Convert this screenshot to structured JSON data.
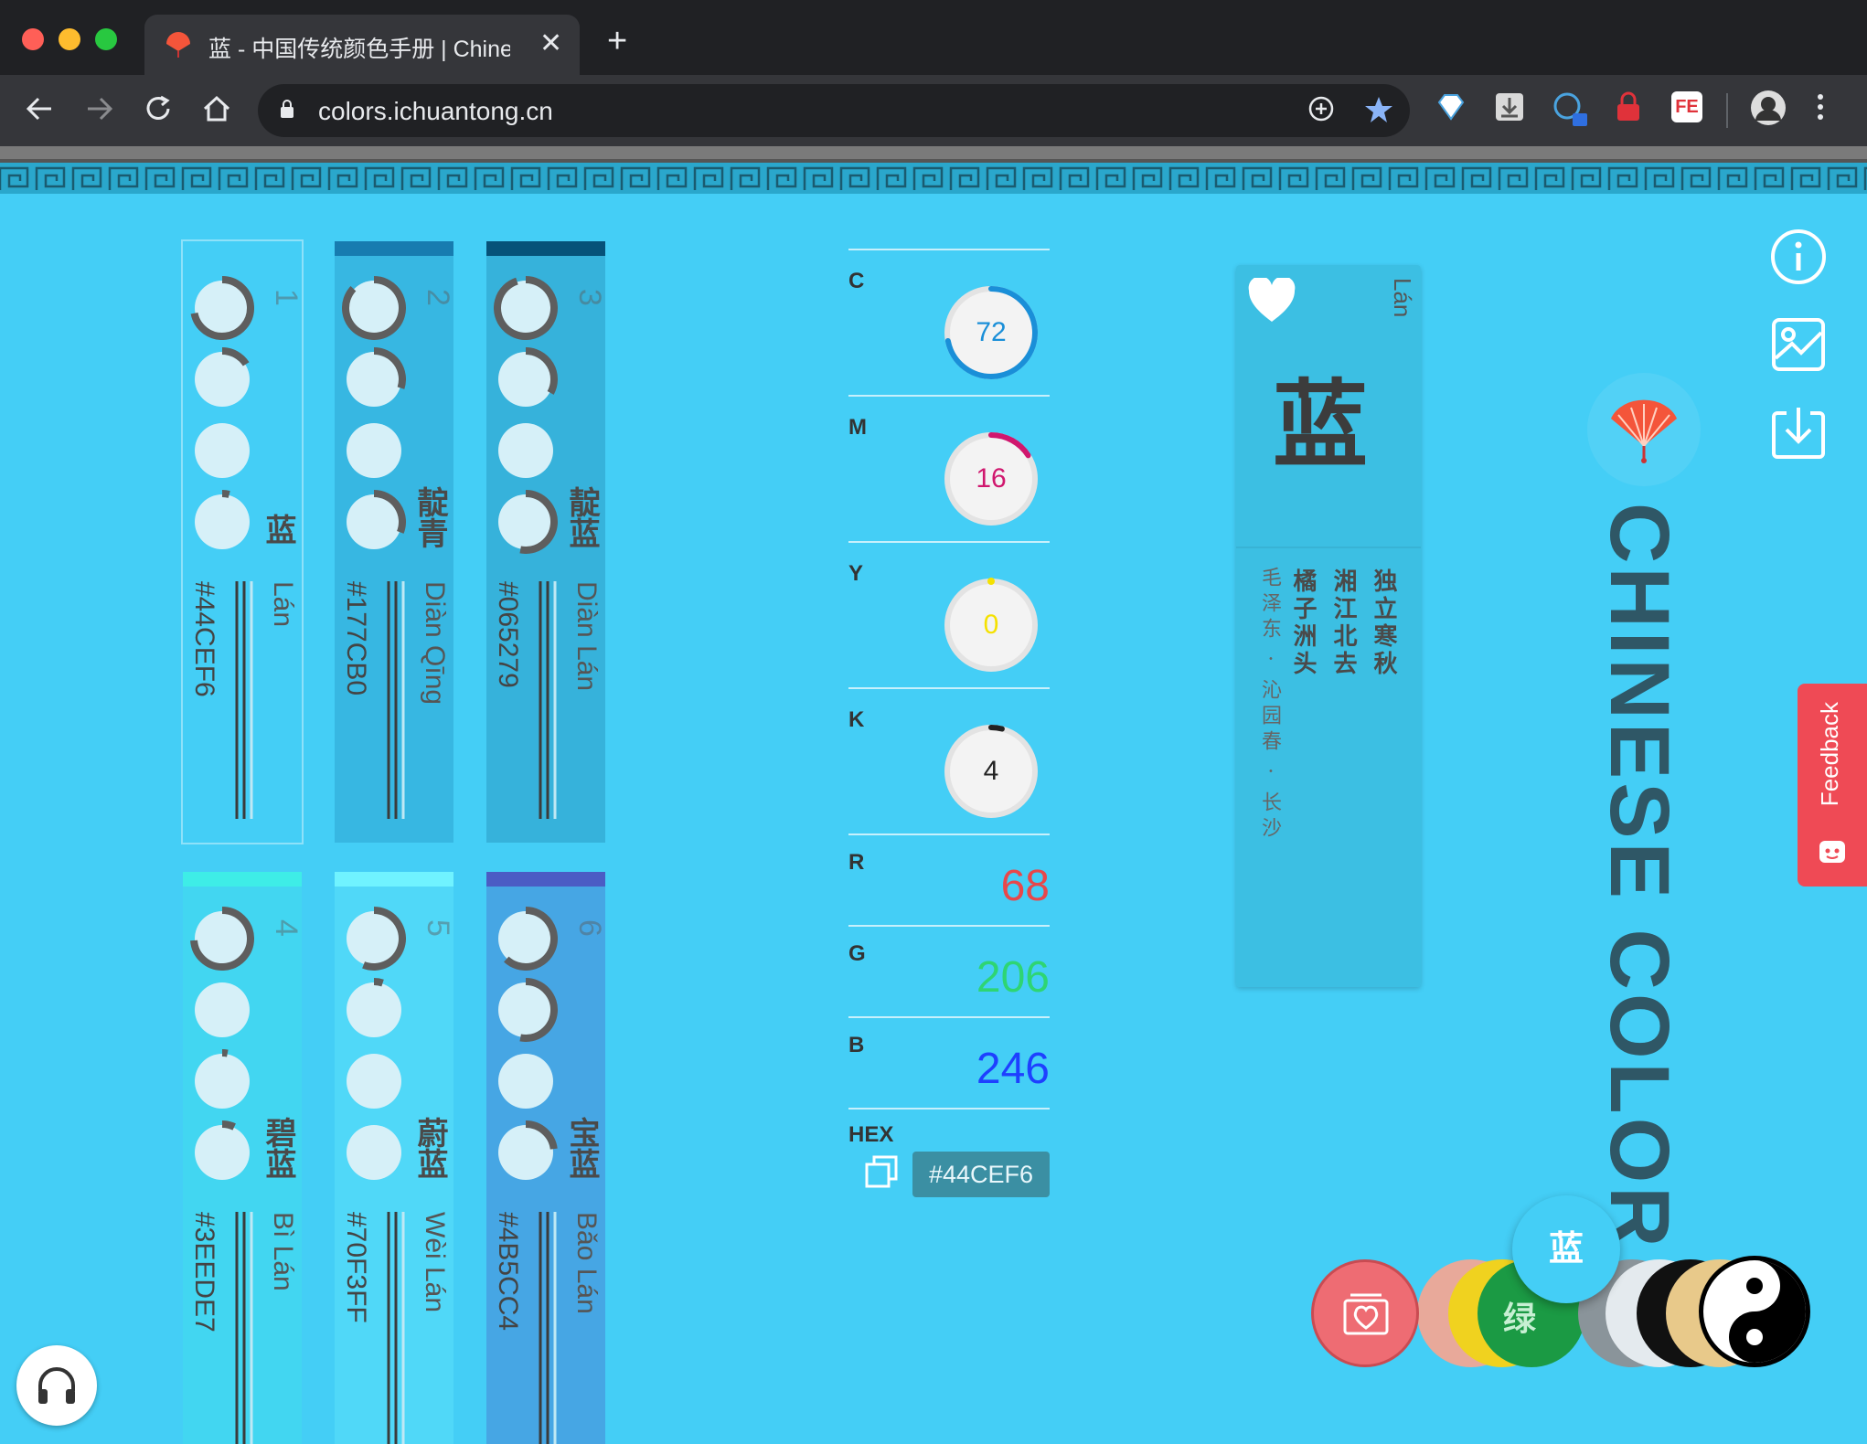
{
  "browser": {
    "tab_title": "蓝 - 中国传统颜色手册 | Chinese",
    "tab_close": "✕",
    "new_tab": "+",
    "url": "colors.ichuantong.cn",
    "ext_fe_label": "FE"
  },
  "palette": [
    {
      "index": "1",
      "name": "蓝",
      "pinyin": "Lán",
      "hex": "#44CEF6",
      "bar": "#44CEF6"
    },
    {
      "index": "2",
      "name": "靛青",
      "pinyin": "Diàn Qīng",
      "hex": "#177CB0",
      "bar": "#177CB0"
    },
    {
      "index": "3",
      "name": "靛蓝",
      "pinyin": "Diàn Lán",
      "hex": "#065279",
      "bar": "#065279"
    },
    {
      "index": "4",
      "name": "碧蓝",
      "pinyin": "Bì Lán",
      "hex": "#3EEDE7",
      "bar": "#3EEDE7"
    },
    {
      "index": "5",
      "name": "蔚蓝",
      "pinyin": "Wèi Lán",
      "hex": "#70F3FF",
      "bar": "#70F3FF"
    },
    {
      "index": "6",
      "name": "宝蓝",
      "pinyin": "Bǎo Lán",
      "hex": "#4B5CC4",
      "bar": "#4B5CC4"
    }
  ],
  "cmyk": {
    "c_label": "C",
    "c_value": "72",
    "m_label": "M",
    "m_value": "16",
    "y_label": "Y",
    "y_value": "0",
    "k_label": "K",
    "k_value": "4"
  },
  "rgb": {
    "r_label": "R",
    "r_value": "68",
    "g_label": "G",
    "g_value": "206",
    "b_label": "B",
    "b_value": "246"
  },
  "hex": {
    "label": "HEX",
    "value": "#44CEF6"
  },
  "detail": {
    "character": "蓝",
    "pinyin": "Lán",
    "poem_col1": "独立寒秋",
    "poem_col2": "湘江北去",
    "poem_col3": "橘子洲头",
    "author": "毛泽东 · 沁园春 · 长沙"
  },
  "site_title": "CHINESE COLOR",
  "feedback_label": "Feedback",
  "swatches": {
    "current_label": "蓝",
    "green_label": "绿"
  },
  "colors": {
    "background": "#44CEF6",
    "feedback": "#ef4a55",
    "cyan_dial": "#1a8fd8",
    "magenta_dial": "#d0176e",
    "yellow_dial": "#f5e100",
    "key_dial": "#222222",
    "r_text": "#e8474a",
    "g_text": "#2ed573",
    "b_text": "#1e40ff"
  },
  "cmyk_levels": {
    "c": 0.72,
    "m": 0.16,
    "y": 0.0,
    "k": 0.04
  }
}
